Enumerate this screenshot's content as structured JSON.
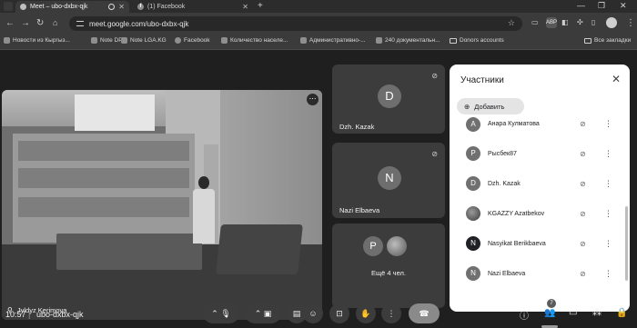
{
  "browser": {
    "tabs": [
      {
        "title": "Meet – ubo-dxbx-qjk",
        "active": true
      },
      {
        "title": "(1) Facebook",
        "active": false
      }
    ],
    "new_tab": "+",
    "window_controls": {
      "minimize": "—",
      "maximize": "❐",
      "close": "✕"
    },
    "url": "meet.google.com/ubo-dxbx-qjk",
    "extensions": [
      "ABP"
    ],
    "bookmarks": [
      {
        "label": "Новости из Кыргыз...",
        "icon": "site-icon"
      },
      {
        "label": "Note DPI",
        "icon": "site-icon"
      },
      {
        "label": "Note LGA.KG",
        "icon": "site-icon"
      },
      {
        "label": "Facebook",
        "icon": "facebook-icon"
      },
      {
        "label": "Количество населе...",
        "icon": "site-icon"
      },
      {
        "label": "Административно-...",
        "icon": "site-icon"
      },
      {
        "label": "240 документальн...",
        "icon": "site-icon"
      },
      {
        "label": "Donors accounts",
        "icon": "folder-icon"
      }
    ],
    "all_bookmarks": "Все закладки"
  },
  "meet": {
    "main_video": {
      "name": "Jyldyz Kerimova",
      "more": "⋯"
    },
    "tiles": [
      {
        "initial": "D",
        "name": "Dzh. Kazak"
      },
      {
        "initial": "N",
        "name": "Nazi Elbaeva"
      }
    ],
    "others": {
      "initial": "P",
      "label": "Ещё 4 чел."
    },
    "panel": {
      "title": "Участники",
      "add_label": "Добавить",
      "participants": [
        {
          "initial": "А",
          "name": "Анара Кулматова",
          "avatar": "plain"
        },
        {
          "initial": "P",
          "name": "Рысбек87",
          "avatar": "plain"
        },
        {
          "initial": "D",
          "name": "Dzh. Kazak",
          "avatar": "plain"
        },
        {
          "initial": "",
          "name": "KGAZZY Azatbekov",
          "avatar": "photo"
        },
        {
          "initial": "N",
          "name": "Nasyikat Berikbaeva",
          "avatar": "dark"
        },
        {
          "initial": "N",
          "name": "Nazi Elbaeva",
          "avatar": "plain"
        }
      ]
    },
    "bottom": {
      "time": "10:57",
      "separator": "|",
      "code": "ubo-dxbx-qjk",
      "participant_count": "7"
    }
  }
}
